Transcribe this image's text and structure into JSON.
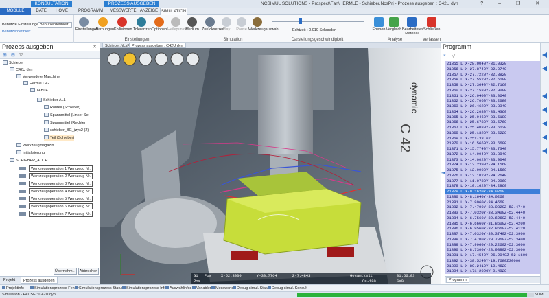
{
  "titlebar": {
    "context1": "KONSULTATION",
    "context2": "PROZESS AUSGEBEN",
    "title": "NCSIMUL SOLUTIONS - Prospect\\Fan\\HERMLE - Schieber.NcsPrj - Prozess ausgeben : C42U dyn",
    "window_buttons": "? – ❐ ✕"
  },
  "tabs": [
    "MODULE",
    "DATEI",
    "HOME",
    "PROGRAMM",
    "MESSWERTE",
    "ANZEIGE",
    "SIMULATION"
  ],
  "ribbon": {
    "settings_label": "Benutzte Einstellungen",
    "settings_value": "Benutzerdefiniert",
    "settings_sub": "Benutzerdefiniert",
    "group_einstellungen": "Einstellungen",
    "group_simulation": "Simulation",
    "group_speed": "Darstellungsgeschwindigkeit",
    "group_analyse": "Analyse",
    "group_verlassen": "Verlassen",
    "speed_value": "Echtzeit : 0.010 Sekunden",
    "buttons": {
      "einstellungen": "Einstellungen",
      "warnungen": "Warnungen",
      "kollisionen": "Kollisionen",
      "toleranzen": "Toleranzen",
      "optionen": "Optionen",
      "heilepunkte": "Heilepunkte",
      "medium": "Medium",
      "zuruecksetzen": "Zurücksetzen",
      "play": "Play",
      "pause": "Pause",
      "werkzeugauswahl": "Werkzeugauswahl",
      "ebenen": "Ebenen",
      "vergleich": "Vergleich",
      "bearbeitetes": "Bearbeitetes Material",
      "schliessen": "Schließen"
    }
  },
  "colors": {
    "accent": "#2b6cc4",
    "program_bg": "#c9c9f0",
    "highlight": "#3d7fd9",
    "progress": "#2bb33b",
    "part": "#c7dd3a"
  },
  "left_panel": {
    "title": "Prozess ausgeben",
    "tree": [
      {
        "label": "Schieber",
        "level": 0
      },
      {
        "label": "C42U dyn",
        "level": 1
      },
      {
        "label": "Verwendete Maschine",
        "level": 2
      },
      {
        "label": "Hermle C42",
        "level": 3
      },
      {
        "label": "TABLE",
        "level": 4
      },
      {
        "label": "Schieber ALL",
        "level": 4
      },
      {
        "label": "Rohteil (Schieber)",
        "level": 5
      },
      {
        "label": "Spannmittel (Linker Se",
        "level": 5
      },
      {
        "label": "Spannmittel (Rechter",
        "level": 5
      },
      {
        "label": "schieber_BG_(zys2 (2)",
        "level": 5
      },
      {
        "label": "Teil (Schieber)",
        "level": 5
      },
      {
        "label": "Werkzeugmagazin",
        "level": 2
      },
      {
        "label": "Initialisierung",
        "level": 2
      },
      {
        "label": "SCHIEBER_ALL.H",
        "level": 1
      },
      {
        "label": "Werkzeugoperation 1 Werkzeug Nr.",
        "level": 2
      },
      {
        "label": "Werkzeugoperation 2 Werkzeug Nr.",
        "level": 2
      },
      {
        "label": "Werkzeugoperation 3 Werkzeug Nr.",
        "level": 2
      },
      {
        "label": "Werkzeugoperation 4 Werkzeug Nr.",
        "level": 2
      },
      {
        "label": "Werkzeugoperation 5 Werkzeug Nr.",
        "level": 2
      },
      {
        "label": "Werkzeugoperation 6 Werkzeug Nr.",
        "level": 2
      },
      {
        "label": "Werkzeugoperation 7 Werkzeug Nr.",
        "level": 2
      }
    ],
    "btn_uebernehmen": "Übernehm...",
    "btn_abbrechen": "Abbrechen",
    "tabs": [
      "Projekt",
      "Prozess ausgeben"
    ]
  },
  "view_tabs": [
    "Schieber.NcsPrj",
    "Prozess ausgeben : C42U dyn"
  ],
  "viewport": {
    "machine_label": "dynamic",
    "model_label": "C 42",
    "overlay": {
      "g": "G1",
      "feed_label": "Pos",
      "x": "X-52.3000",
      "y": "Y-30.7764",
      "z": "Z-7.4843",
      "gesamtzeit_label": "Gesamtzeit",
      "gesamtzeit": "01:56:03",
      "c": "C=-180",
      "s": "S=0",
      "pos2": "Pos"
    }
  },
  "right_panel": {
    "title": "Programm",
    "lines": [
      "21355 L X-28.0040Y-31.0320",
      "21356 L X-27.8740Y-32.0740",
      "21357 L X-27.7220Y-32.3920",
      "21358 L X-27.5520Y-32.5100",
      "21359 L X-27.3640Y-32.7160",
      "21360 L X-27.1580Y-32.9000",
      "21361 L X-26.9400Y-33.0640",
      "21362 L X-26.7060Y-33.2080",
      "21363 L X-26.4620Y-33.3340",
      "21364 L X-26.2080Y-33.4360",
      "21365 L X-25.9460Y-33.5180",
      "21366 L X-25.6780Y-33.5760",
      "21367 L X-25.4080Y-33.6120",
      "21368 L X-25.1320Y-33.6220",
      "21369 L X-25Y-33.62",
      "21370 L X-16.5660Y-33.6600",
      "21371 L X-15.7740Y-33.7340",
      "21372 L X-14.9940Y-33.8840",
      "21373 L X-14.0020Y-33.9040",
      "21374 L X-13.2390Y-34.1560",
      "21375 L X-12.9900Y-34.1560",
      "21376 L X-12.1020Y-34.2640",
      "21377 L X-11.0730Y-34.2960",
      "21378 L X-10.1620Y-34.2960",
      "21379 L X-9.1620Y-34.0260",
      "21380 L X-8.1640Y-34.0260",
      "21381 L X-7.9960Y-34.4560",
      "21382 L X-7.4700Y-33.0820Z-52.4740",
      "21383 L X-7.0320Y-33.3400Z-52.4440",
      "21384 L X-6.7560Y-32.6260Z-52.4440",
      "21385 L X-6.6660Y-31.8600Z-52.4200",
      "21386 L X-6.9560Y-32.8660Z-52.4120",
      "21387 L X-7.0320Y-30.3740Z-52.3900",
      "21388 L X-7.4700Y-29.7860Z-52.3400",
      "21389 L X-7.9960Y-29.2260Z-52.3600",
      "21390 L X-8.7300Y-28.9880Z-52.3000",
      "21391 L X-17.4540Y-26.2040Z-52.1600",
      "21392 L X-38.5240Y-19.7680Z30000",
      "21393 L X-89.2410Y-19.4620",
      "21394 L X-171.2020Y-9.4820",
      "21395 L X-174.5180Y3.5420",
      "21396 L X-176.5420Y1.9420",
      "21397 L X-177.8460Y3.2940",
      "21398 L X-178.1380Y4.2100",
      "21399 L X-181.5600Y4.4660",
      "21400 L X-182.1480Y4.4660",
      "21401 L X-184.1080Y4.4600",
      "21402 L X-184.5380Y4.5400",
      "21403 L X-185.1230Y4.0430",
      "21404 L X-186.3700Y4.3600"
    ],
    "highlight_index": 24,
    "tab": "Programm"
  },
  "bottom_tabs": [
    "Projektinfo",
    "Simulationsprozess Fehler",
    "Simulationsprozess Status",
    "Simulationsprozess Infos",
    "Auswahlinfos",
    "Variablen",
    "Messwerte",
    "Debug simul. Status",
    "Debug simul. Konsult"
  ],
  "status": {
    "text": "Simulation - PAUSE : C42U dyn",
    "progress_fraction": 0.97,
    "right": "NUM"
  }
}
